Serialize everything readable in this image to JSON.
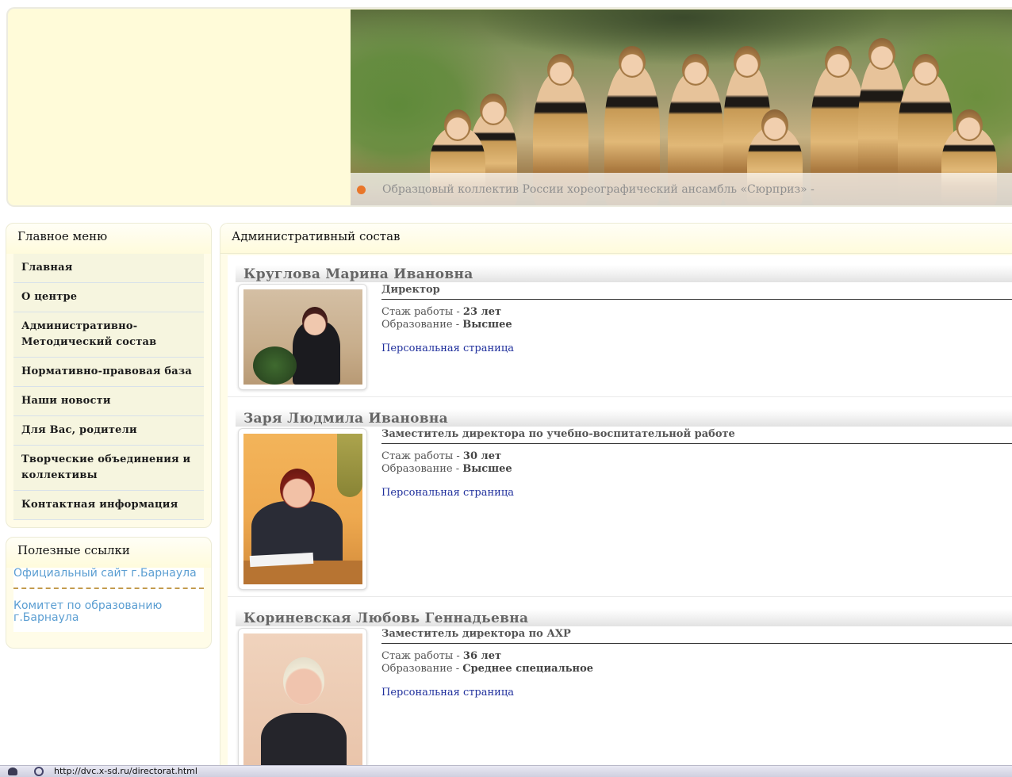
{
  "banner": {
    "caption": "Образцовый коллектив России хореографический ансамбль «Сюрприз» -",
    "photo_icon": "dancers-photo"
  },
  "sidebar": {
    "menu_title": "Главное меню",
    "menu_items": [
      {
        "label": "Главная"
      },
      {
        "label": "О центре"
      },
      {
        "label": "Административно-Методический состав"
      },
      {
        "label": "Нормативно-правовая база"
      },
      {
        "label": "Наши новости"
      },
      {
        "label": "Для Вас, родители"
      },
      {
        "label": "Творческие объединения и коллективы"
      },
      {
        "label": "Контактная информация"
      }
    ],
    "links_title": "Полезные ссылки",
    "links": [
      {
        "label": "Официальный сайт г.Барнаула"
      },
      {
        "label": "Комитет по образованию г.Барнаула"
      }
    ]
  },
  "main": {
    "title": "Административный состав",
    "people": [
      {
        "name": "Круглова Марина Ивановна",
        "position": "Директор",
        "experience_label": "Стаж работы - ",
        "experience_value": "23 лет",
        "education_label": "Образование - ",
        "education_value": "Высшее",
        "link": "Персональная страница"
      },
      {
        "name": "Заря Людмила Ивановна",
        "position": "Заместитель директора по учебно-воспитательной работе",
        "experience_label": "Стаж работы - ",
        "experience_value": "30 лет",
        "education_label": "Образование - ",
        "education_value": "Высшее",
        "link": "Персональная страница"
      },
      {
        "name": "Кориневская Любовь Геннадьевна",
        "position": "Заместитель директора по АХР",
        "experience_label": "Стаж работы - ",
        "experience_value": "36 лет",
        "education_label": "Образование - ",
        "education_value": "Среднее специальное",
        "link": "Персональная страница"
      }
    ]
  },
  "statusbar": {
    "url": "http://dvc.x-sd.ru/directorat.html"
  },
  "colors": {
    "header_bg": "#fffbd9",
    "accent_dot": "#e9762a",
    "link_blue": "#1f2f9c",
    "sidebar_link": "#5b9ed2",
    "dashed_separator": "#c39b4e"
  }
}
